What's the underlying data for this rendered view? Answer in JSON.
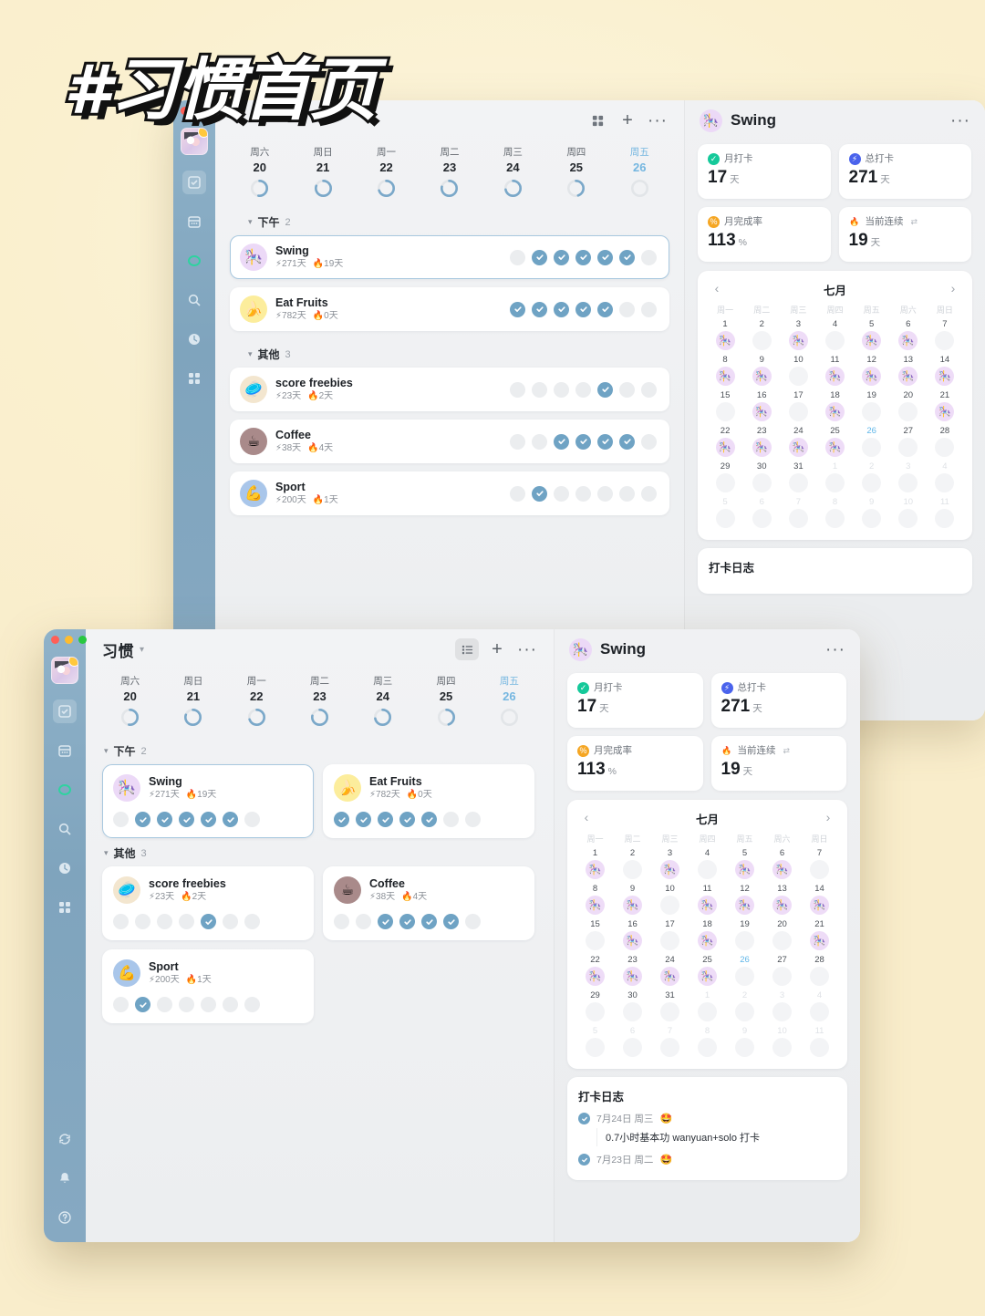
{
  "overlay_title": "#习惯首页",
  "window": {
    "title": "习惯",
    "toolbar": {
      "view_list_icon": "list-view-icon",
      "view_grid_icon": "grid-view-icon",
      "add_label": "+",
      "more_label": "···"
    }
  },
  "sidebar": {
    "items": [
      {
        "name": "tasks",
        "icon": "check-square-icon"
      },
      {
        "name": "calendar",
        "icon": "calendar-icon"
      },
      {
        "name": "habits",
        "icon": "habit-ring-icon"
      },
      {
        "name": "search",
        "icon": "search-icon"
      },
      {
        "name": "pomodoro",
        "icon": "clock-icon"
      },
      {
        "name": "matrix",
        "icon": "grid-four-icon"
      }
    ],
    "bottom_items": [
      {
        "name": "sync",
        "icon": "sync-icon"
      },
      {
        "name": "notifications",
        "icon": "bell-icon"
      },
      {
        "name": "help",
        "icon": "help-icon"
      }
    ]
  },
  "week": [
    {
      "day": "周六",
      "date": "20",
      "progress": 52,
      "today": false
    },
    {
      "day": "周日",
      "date": "21",
      "progress": 80,
      "today": false
    },
    {
      "day": "周一",
      "date": "22",
      "progress": 70,
      "today": false
    },
    {
      "day": "周二",
      "date": "23",
      "progress": 78,
      "today": false
    },
    {
      "day": "周三",
      "date": "24",
      "progress": 72,
      "today": false
    },
    {
      "day": "周四",
      "date": "25",
      "progress": 45,
      "today": false
    },
    {
      "day": "周五",
      "date": "26",
      "progress": 0,
      "today": true
    }
  ],
  "sections": [
    {
      "label": "下午",
      "count": "2",
      "habits": [
        {
          "name": "Swing",
          "emoji": "🎠",
          "emoji_bg": "#ecd9f7",
          "total": "271天",
          "streak": "19天",
          "selected": true,
          "checks": [
            false,
            true,
            true,
            true,
            true,
            true,
            false
          ]
        },
        {
          "name": "Eat Fruits",
          "emoji": "🍌",
          "emoji_bg": "#fced9c",
          "total": "782天",
          "streak": "0天",
          "selected": false,
          "checks": [
            true,
            true,
            true,
            true,
            true,
            false,
            false
          ]
        }
      ]
    },
    {
      "label": "其他",
      "count": "3",
      "habits": [
        {
          "name": "score freebies",
          "emoji": "🥏",
          "emoji_bg": "#f3e6cf",
          "total": "23天",
          "streak": "2天",
          "selected": false,
          "checks": [
            false,
            false,
            false,
            false,
            true,
            false,
            false
          ]
        },
        {
          "name": "Coffee",
          "emoji": "☕",
          "emoji_bg": "#a98a8a",
          "total": "38天",
          "streak": "4天",
          "selected": false,
          "checks": [
            false,
            false,
            true,
            true,
            true,
            true,
            false
          ]
        },
        {
          "name": "Sport",
          "emoji": "💪",
          "emoji_bg": "#a9c6ea",
          "total": "200天",
          "streak": "1天",
          "selected": false,
          "checks": [
            false,
            true,
            false,
            false,
            false,
            false,
            false
          ]
        }
      ]
    }
  ],
  "detail": {
    "title": "Swing",
    "emoji": "🎠",
    "emoji_bg": "#ecd9f7",
    "more_label": "···",
    "stats": [
      {
        "label": "月打卡",
        "value": "17",
        "unit": "天",
        "icon": "check-badge-icon",
        "icon_color": "#15c99a",
        "swap": ""
      },
      {
        "label": "总打卡",
        "value": "271",
        "unit": "天",
        "icon": "lightning-icon",
        "icon_color": "#4a63ec",
        "swap": ""
      },
      {
        "label": "月完成率",
        "value": "113",
        "unit": "%",
        "icon": "percent-icon",
        "icon_color": "#f5a623",
        "swap": ""
      },
      {
        "label": "当前连续",
        "value": "19",
        "unit": "天",
        "icon": "flame-icon",
        "icon_color": "#f0473c",
        "swap": "⇄"
      }
    ],
    "calendar": {
      "month": "七月",
      "prev_icon": "chevron-left-icon",
      "next_icon": "chevron-right-icon",
      "dow": [
        "周一",
        "周二",
        "周三",
        "周四",
        "周五",
        "周六",
        "周日"
      ],
      "mark_emoji": "🎠",
      "days": [
        {
          "n": "1",
          "on": true
        },
        {
          "n": "2",
          "on": false
        },
        {
          "n": "3",
          "on": true
        },
        {
          "n": "4",
          "on": false
        },
        {
          "n": "5",
          "on": true
        },
        {
          "n": "6",
          "on": true
        },
        {
          "n": "7",
          "on": false
        },
        {
          "n": "8",
          "on": true
        },
        {
          "n": "9",
          "on": true
        },
        {
          "n": "10",
          "on": false
        },
        {
          "n": "11",
          "on": true
        },
        {
          "n": "12",
          "on": true
        },
        {
          "n": "13",
          "on": true
        },
        {
          "n": "14",
          "on": true
        },
        {
          "n": "15",
          "on": false
        },
        {
          "n": "16",
          "on": true
        },
        {
          "n": "17",
          "on": false
        },
        {
          "n": "18",
          "on": true
        },
        {
          "n": "19",
          "on": false
        },
        {
          "n": "20",
          "on": false
        },
        {
          "n": "21",
          "on": true
        },
        {
          "n": "22",
          "on": true
        },
        {
          "n": "23",
          "on": true
        },
        {
          "n": "24",
          "on": true
        },
        {
          "n": "25",
          "on": true
        },
        {
          "n": "26",
          "on": false,
          "today": true
        },
        {
          "n": "27",
          "on": false
        },
        {
          "n": "28",
          "on": false
        },
        {
          "n": "29",
          "on": false
        },
        {
          "n": "30",
          "on": false
        },
        {
          "n": "31",
          "on": false
        },
        {
          "n": "1",
          "on": false,
          "out": true
        },
        {
          "n": "2",
          "on": false,
          "out": true
        },
        {
          "n": "3",
          "on": false,
          "out": true
        },
        {
          "n": "4",
          "on": false,
          "out": true
        },
        {
          "n": "5",
          "on": false,
          "out": true
        },
        {
          "n": "6",
          "on": false,
          "out": true
        },
        {
          "n": "7",
          "on": false,
          "out": true
        },
        {
          "n": "8",
          "on": false,
          "out": true
        },
        {
          "n": "9",
          "on": false,
          "out": true
        },
        {
          "n": "10",
          "on": false,
          "out": true
        },
        {
          "n": "11",
          "on": false,
          "out": true
        }
      ]
    },
    "log": {
      "title": "打卡日志",
      "entries": [
        {
          "date": "7月24日 周三",
          "emoji": "🤩",
          "body": "0.7小时基本功 wanyuan+solo 打卡"
        },
        {
          "date": "7月23日 周二",
          "emoji": "🤩",
          "body": ""
        }
      ]
    }
  }
}
